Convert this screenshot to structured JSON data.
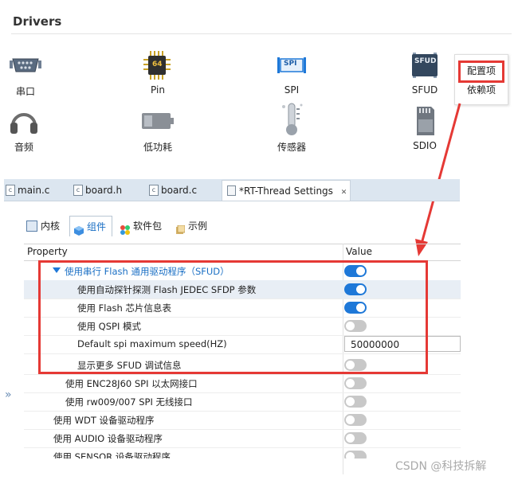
{
  "section_title": "Drivers",
  "drivers": [
    {
      "label": "串口",
      "icon": "serial-port-icon"
    },
    {
      "label": "Pin",
      "icon": "chip-icon",
      "chip_text": "64"
    },
    {
      "label": "SPI",
      "icon": "spi-icon",
      "chip_text": "SPI"
    },
    {
      "label": "SFUD",
      "icon": "sfud-icon",
      "chip_text": "SFUD"
    },
    {
      "label": "音频",
      "icon": "headphones-icon"
    },
    {
      "label": "低功耗",
      "icon": "battery-icon"
    },
    {
      "label": "传感器",
      "icon": "thermometer-icon"
    },
    {
      "label": "SDIO",
      "icon": "sd-card-icon"
    }
  ],
  "context_menu": {
    "items": [
      "配置项",
      "依赖项"
    ]
  },
  "editor_tabs": [
    {
      "label": "main.c"
    },
    {
      "label": "board.h"
    },
    {
      "label": "board.c"
    },
    {
      "label": "*RT-Thread Settings",
      "close": "✕"
    }
  ],
  "settings_tabs": [
    {
      "label": "内核"
    },
    {
      "label": "组件"
    },
    {
      "label": "软件包"
    },
    {
      "label": "示例"
    }
  ],
  "table": {
    "col_property": "Property",
    "col_value": "Value",
    "rows": [
      {
        "label": "使用串行 Flash 通用驱动程序（SFUD）",
        "type": "toggle",
        "on": true
      },
      {
        "label": "使用自动探针探测 Flash JEDEC SFDP 参数",
        "type": "toggle",
        "on": true
      },
      {
        "label": "使用 Flash 芯片信息表",
        "type": "toggle",
        "on": true
      },
      {
        "label": "使用 QSPI 模式",
        "type": "toggle",
        "on": false
      },
      {
        "label": "Default spi maximum speed(HZ)",
        "type": "text",
        "value": "50000000"
      },
      {
        "label": "显示更多 SFUD 调试信息",
        "type": "toggle",
        "on": false
      },
      {
        "label": "使用 ENC28J60 SPI 以太网接口",
        "type": "toggle",
        "on": false
      },
      {
        "label": "使用 rw009/007 SPI 无线接口",
        "type": "toggle",
        "on": false
      },
      {
        "label": "使用 WDT 设备驱动程序",
        "type": "toggle",
        "on": false
      },
      {
        "label": "使用 AUDIO 设备驱动程序",
        "type": "toggle",
        "on": false
      },
      {
        "label": "使用 SENSOR 设备驱动程序",
        "type": "toggle",
        "on": false
      }
    ]
  },
  "collapse_glyph": "»",
  "watermark": "CSDN @科技拆解",
  "colors": {
    "accent": "#1e78d8",
    "highlight": "#e53935"
  }
}
